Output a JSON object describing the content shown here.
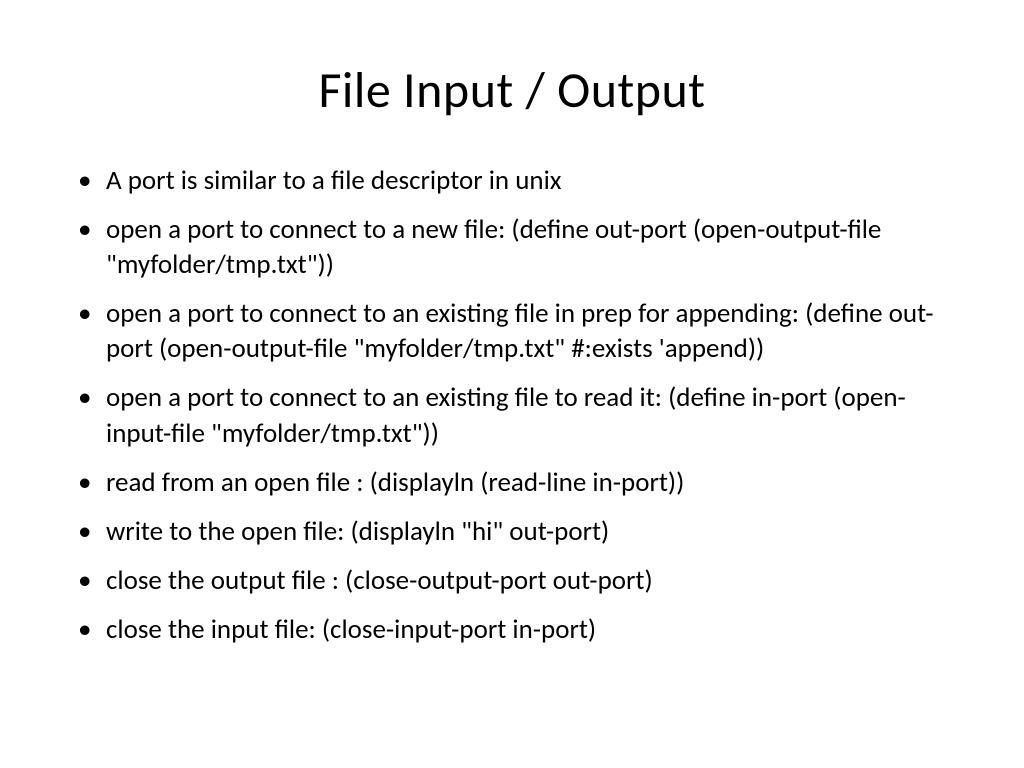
{
  "slide": {
    "title": "File Input / Output",
    "bullets": [
      "A port is similar to a file descriptor in unix",
      "open a port to connect to a new file: (define out-port (open-output-file \"myfolder/tmp.txt\"))",
      "open a port to connect to an existing file in prep for appending: (define out-port (open-output-file \"myfolder/tmp.txt\" #:exists 'append))",
      "open a port to connect to an existing file to read it: (define in-port (open-input-file \"myfolder/tmp.txt\"))",
      "read from an open file : (displayln (read-line in-port))",
      "write to the open file: (displayln \"hi\" out-port)",
      "close the output file : (close-output-port out-port)",
      "close the input file: (close-input-port in-port)"
    ]
  }
}
